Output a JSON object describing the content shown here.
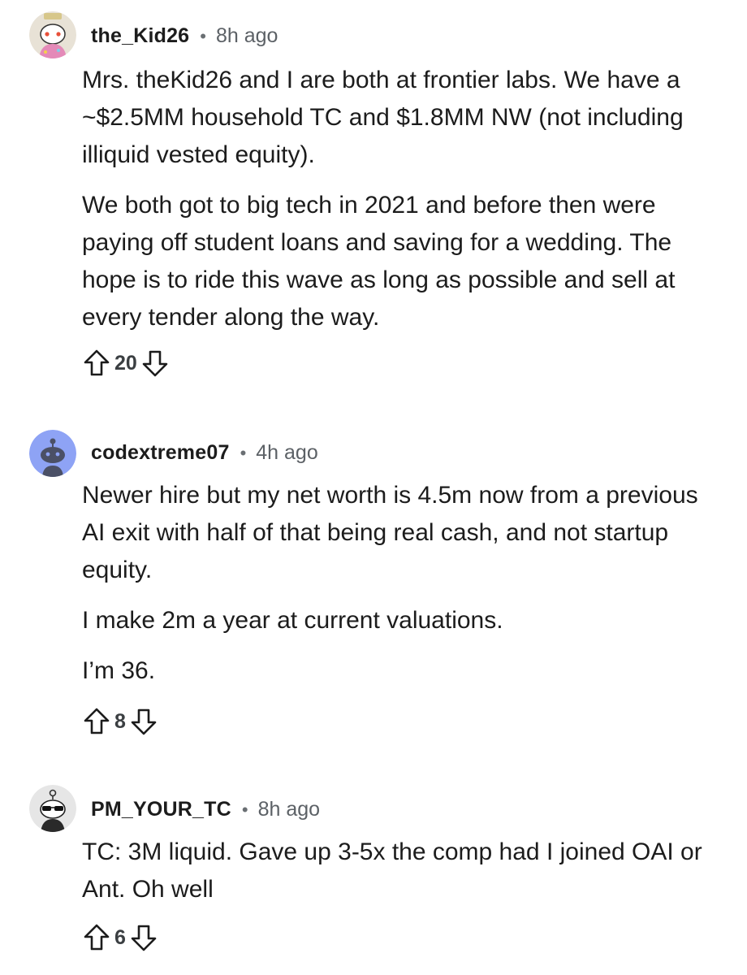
{
  "comments": [
    {
      "author": "the_Kid26",
      "time": "8h ago",
      "paragraphs": [
        "Mrs. theKid26 and I are both at frontier labs. We have a ~$2.5MM household TC and $1.8MM NW (not including illiquid vested equity).",
        "We both got to big tech in 2021 and before then were paying off student loans and saving for a wedding. The hope is to ride this wave as long as possible and sell at every tender along the way."
      ],
      "score": "20"
    },
    {
      "author": "codextreme07",
      "time": "4h ago",
      "paragraphs": [
        "Newer hire but my net worth is 4.5m now from a previous AI exit with half of that being real cash, and not startup equity.",
        "I make 2m a year at current valuations.",
        "I’m 36."
      ],
      "score": "8"
    },
    {
      "author": "PM_YOUR_TC",
      "time": "8h ago",
      "paragraphs": [
        "TC: 3M liquid. Gave up 3-5x the comp had I joined OAI or Ant. Oh well"
      ],
      "score": "6"
    }
  ],
  "separator": "•",
  "icons": {
    "upvote": "upvote-arrow-icon",
    "downvote": "downvote-arrow-icon"
  },
  "colors": {
    "text": "#1c1c1c",
    "meta": "#5c6166",
    "icon": "#1c1c1c",
    "default_avatar_bg": "#8ea3f5"
  }
}
